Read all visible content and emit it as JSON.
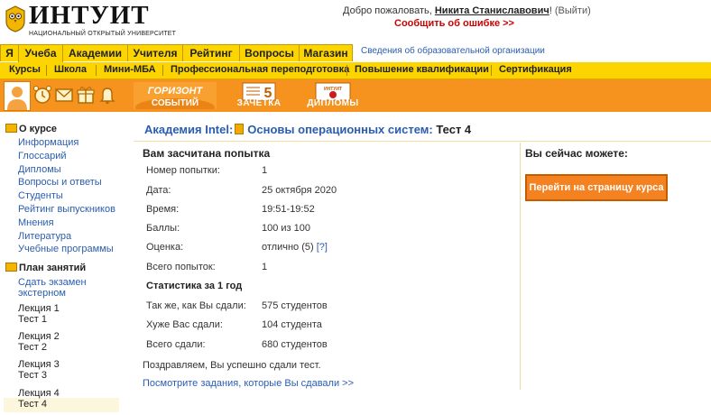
{
  "header": {
    "logo_word": "ИНТУИТ",
    "logo_subtitle": "НАЦИОНАЛЬНЫЙ ОТКРЫТЫЙ УНИВЕРСИТЕТ",
    "welcome_prefix": "Добро пожаловать,",
    "user_name": "Никита Станиславович",
    "welcome_suffix": "!",
    "logout": "(Выйти)",
    "error_link": "Сообщить об ошибке >>"
  },
  "tabs": [
    "Я",
    "Учеба",
    "Академии",
    "Учителя",
    "Рейтинг",
    "Вопросы",
    "Магазин"
  ],
  "tabs_info": "Сведения об образовательной организации",
  "subnav": [
    "Курсы",
    "Школа",
    "Мини-МБА",
    "Профессиональная переподготовка",
    "Повышение квалификации",
    "Сертификация"
  ],
  "banners": {
    "horizon": "ГОРИЗОНТ СОБЫТИЙ",
    "horizon_line1": "ГОРИЗОНТ",
    "horizon_line2": "СОБЫТИЙ",
    "gradebook_num": "5",
    "gradebook": "ЗАЧЕТКА",
    "diplomas_badge": "ИНТУИТ",
    "diplomas": "ДИПЛОМЫ"
  },
  "sidebar": {
    "about_title": "О курсе",
    "about_links": [
      "Информация",
      "Глоссарий",
      "Дипломы",
      "Вопросы и ответы",
      "Студенты",
      "Рейтинг выпускников",
      "Мнения",
      "Литература",
      "Учебные программы"
    ],
    "plan_title": "План занятий",
    "plan_items": [
      {
        "line1": "Сдать экзамен",
        "line2": "экстерном",
        "link": true
      },
      {
        "line1": "Лекция 1",
        "line2": "Тест 1",
        "link": false
      },
      {
        "line1": "Лекция 2",
        "line2": "Тест 2",
        "link": false
      },
      {
        "line1": "Лекция 3",
        "line2": "Тест 3",
        "link": false
      },
      {
        "line1": "Лекция 4",
        "line2": "Тест 4",
        "link": false
      }
    ]
  },
  "breadcrumb": {
    "academy": "Академия Intel:",
    "course": "Основы операционных систем:",
    "test": "Тест 4"
  },
  "attempt": {
    "title": "Вам засчитана попытка",
    "rows": [
      {
        "label": "Номер попытки:",
        "value": "1"
      },
      {
        "label": "Дата:",
        "value": "25 октября 2020"
      },
      {
        "label": "Время:",
        "value": "19:51-19:52"
      },
      {
        "label": "Баллы:",
        "value": "100 из 100"
      },
      {
        "label": "Оценка:",
        "value": "отлично (5)",
        "help": "[?]"
      },
      {
        "label": "Всего попыток:",
        "value": "1"
      }
    ],
    "stats_title": "Статистика за 1 год",
    "stats": [
      {
        "label": "Так же, как Вы сдали:",
        "value": "575 студентов"
      },
      {
        "label": "Хуже Вас сдали:",
        "value": "104 студента"
      },
      {
        "label": "Всего сдали:",
        "value": "680 студентов"
      }
    ],
    "congrats": "Поздравляем, Вы успешно сдали тест.",
    "see_tasks": "Посмотрите задания, которые Вы сдавали >>"
  },
  "right": {
    "title": "Вы сейчас можете:",
    "button": "Перейти на страницу курса"
  },
  "colors": {
    "orange": "#f6921e",
    "yellow": "#fcd500",
    "link": "#2a5db0",
    "error": "#cc0000"
  }
}
